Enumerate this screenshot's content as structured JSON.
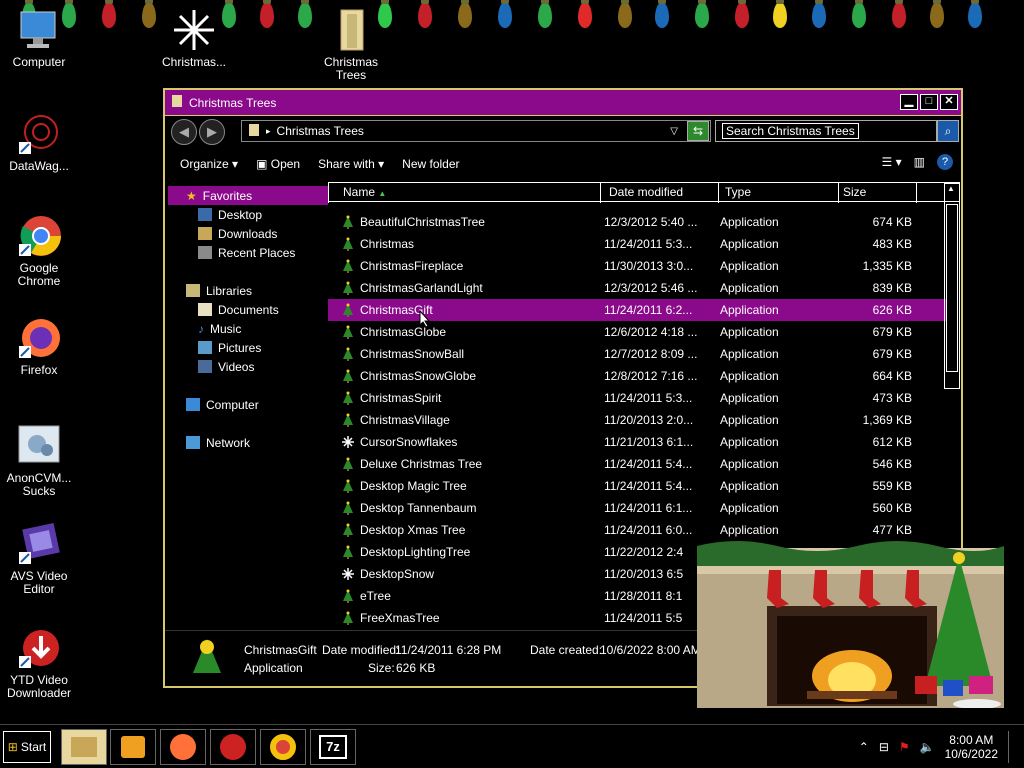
{
  "desktop": {
    "icons": [
      {
        "label": "Computer"
      },
      {
        "label": "Christmas..."
      },
      {
        "label": "Christmas Trees"
      },
      {
        "label": "DataWag..."
      },
      {
        "label": "Google Chrome"
      },
      {
        "label": "Firefox"
      },
      {
        "label": "AnonCVM... Sucks"
      },
      {
        "label": "AVS Video Editor"
      },
      {
        "label": "YTD Video Downloader"
      }
    ]
  },
  "window": {
    "title": "Christmas Trees",
    "address": "Christmas Trees",
    "search_placeholder": "Search Christmas Trees",
    "toolbar": {
      "organize": "Organize",
      "open": "Open",
      "share_with": "Share with",
      "new_folder": "New folder"
    },
    "nav": {
      "favorites": "Favorites",
      "desktop": "Desktop",
      "downloads": "Downloads",
      "recent_places": "Recent Places",
      "libraries": "Libraries",
      "documents": "Documents",
      "music": "Music",
      "pictures": "Pictures",
      "videos": "Videos",
      "computer": "Computer",
      "network": "Network"
    },
    "columns": {
      "name": "Name",
      "date": "Date modified",
      "type": "Type",
      "size": "Size"
    },
    "files": [
      {
        "name": "BeautifulChristmasTree",
        "date": "12/3/2012 5:40 ...",
        "type": "Application",
        "size": "674 KB"
      },
      {
        "name": "Christmas",
        "date": "11/24/2011 5:3...",
        "type": "Application",
        "size": "483 KB"
      },
      {
        "name": "ChristmasFireplace",
        "date": "11/30/2013 3:0...",
        "type": "Application",
        "size": "1,335 KB"
      },
      {
        "name": "ChristmasGarlandLight",
        "date": "12/3/2012 5:46 ...",
        "type": "Application",
        "size": "839 KB"
      },
      {
        "name": "ChristmasGift",
        "date": "11/24/2011 6:2...",
        "type": "Application",
        "size": "626 KB"
      },
      {
        "name": "ChristmasGlobe",
        "date": "12/6/2012 4:18 ...",
        "type": "Application",
        "size": "679 KB"
      },
      {
        "name": "ChristmasSnowBall",
        "date": "12/7/2012 8:09 ...",
        "type": "Application",
        "size": "679 KB"
      },
      {
        "name": "ChristmasSnowGlobe",
        "date": "12/8/2012 7:16 ...",
        "type": "Application",
        "size": "664 KB"
      },
      {
        "name": "ChristmasSpirit",
        "date": "11/24/2011 5:3...",
        "type": "Application",
        "size": "473 KB"
      },
      {
        "name": "ChristmasVillage",
        "date": "11/20/2013 2:0...",
        "type": "Application",
        "size": "1,369 KB"
      },
      {
        "name": "CursorSnowflakes",
        "date": "11/21/2013 6:1...",
        "type": "Application",
        "size": "612 KB"
      },
      {
        "name": "Deluxe Christmas Tree",
        "date": "11/24/2011 5:4...",
        "type": "Application",
        "size": "546 KB"
      },
      {
        "name": "Desktop Magic Tree",
        "date": "11/24/2011 5:4...",
        "type": "Application",
        "size": "559 KB"
      },
      {
        "name": "Desktop Tannenbaum",
        "date": "11/24/2011 6:1...",
        "type": "Application",
        "size": "560 KB"
      },
      {
        "name": "Desktop Xmas Tree",
        "date": "11/24/2011 6:0...",
        "type": "Application",
        "size": "477 KB"
      },
      {
        "name": "DesktopLightingTree",
        "date": "11/22/2012 2:4",
        "type": "",
        "size": ""
      },
      {
        "name": "DesktopSnow",
        "date": "11/20/2013 6:5",
        "type": "",
        "size": ""
      },
      {
        "name": "eTree",
        "date": "11/28/2011 8:1",
        "type": "",
        "size": ""
      },
      {
        "name": "FreeXmasTree",
        "date": "11/24/2011 5:5",
        "type": "",
        "size": ""
      }
    ],
    "details": {
      "name": "ChristmasGift",
      "modified_label": "Date modified:",
      "modified": "11/24/2011 6:28 PM",
      "created_label": "Date created:",
      "created": "10/6/2022 8:00 AM",
      "type": "Application",
      "size_label": "Size:",
      "size": "626 KB"
    }
  },
  "taskbar": {
    "start": "Start",
    "time": "8:00 AM",
    "date": "10/6/2022"
  },
  "colors": {
    "accent": "#8b0a8b",
    "border": "#d6c96a"
  }
}
